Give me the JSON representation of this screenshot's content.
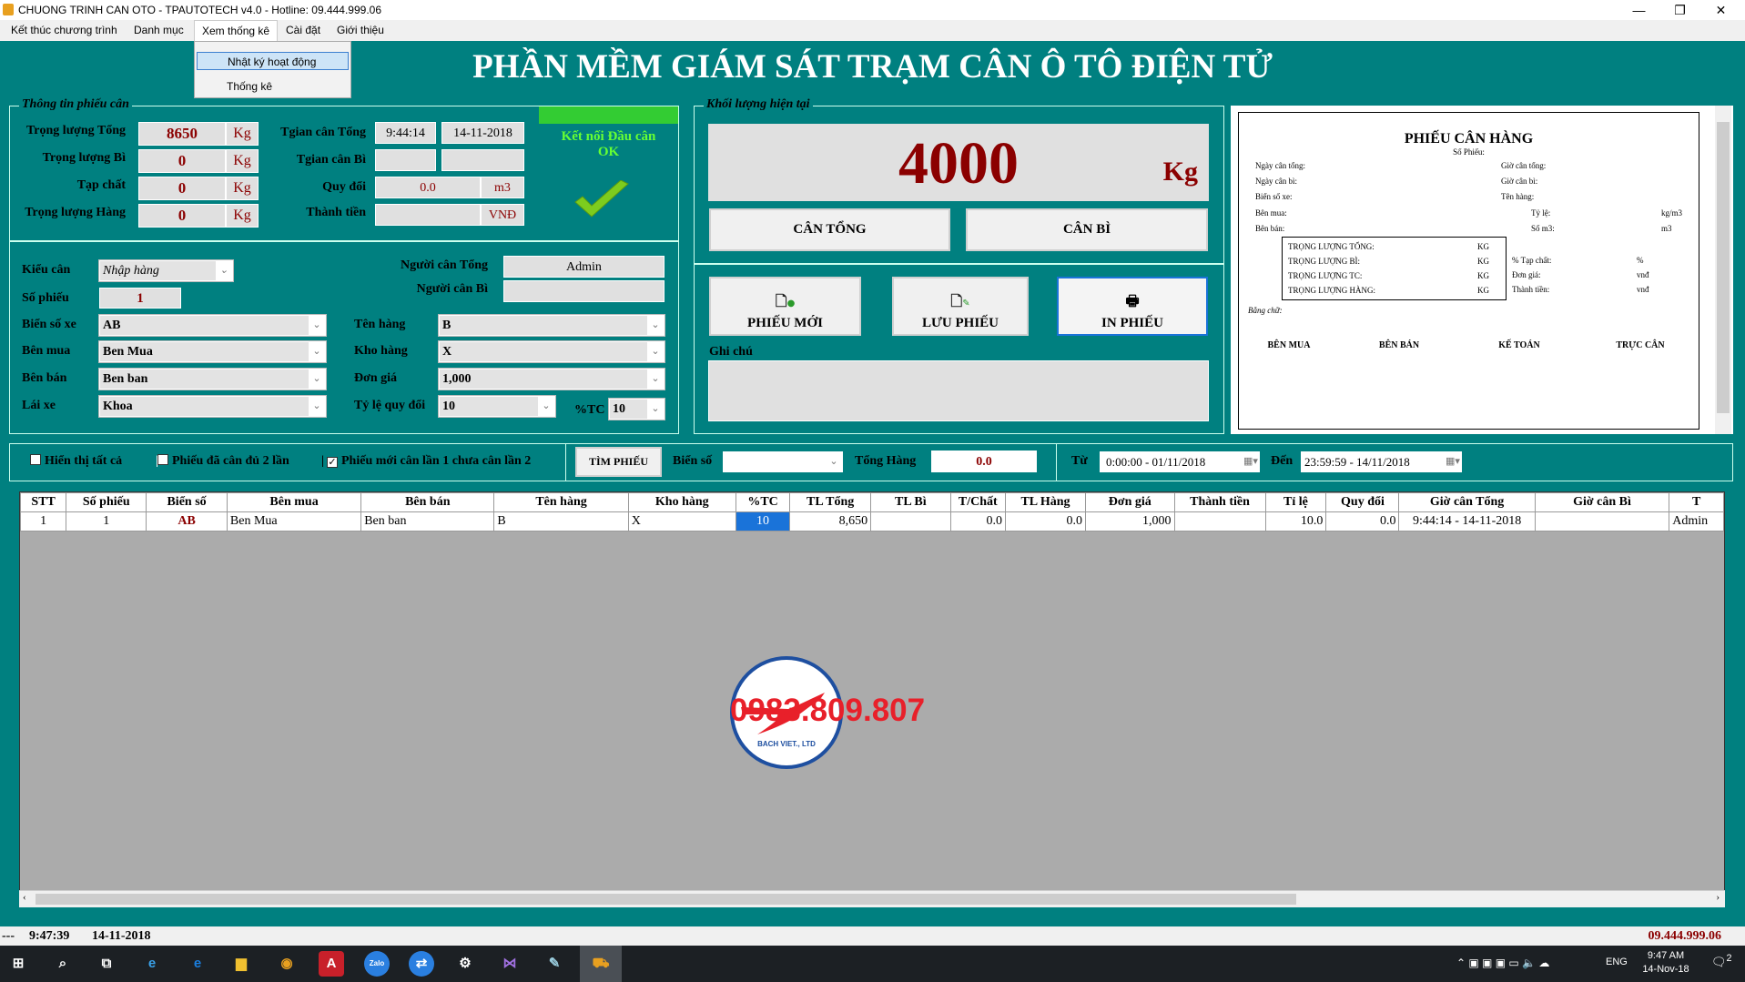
{
  "window": {
    "title": "CHUONG TRINH CAN OTO - TPAUTOTECH v4.0 - Hotline: 09.444.999.06",
    "controls": [
      "—",
      "❐",
      "✕"
    ]
  },
  "menu": {
    "items": [
      "Kết thúc chương trình",
      "Danh mục",
      "Xem thống kê",
      "Cài đặt",
      "Giới thiệu"
    ],
    "open_index": 2,
    "dropdown": [
      "Nhật ký hoạt động",
      "Thống kê"
    ]
  },
  "app_title": "PHẦN MỀM GIÁM SÁT TRẠM CÂN Ô TÔ ĐIỆN TỬ",
  "ticket_info": {
    "legend": "Thông tin phiếu cân",
    "rows": [
      {
        "label": "Trọng lượng Tổng",
        "value": "8650",
        "unit": "Kg"
      },
      {
        "label": "Trọng lượng Bì",
        "value": "0",
        "unit": "Kg"
      },
      {
        "label": "Tạp chất",
        "value": "0",
        "unit": "Kg"
      },
      {
        "label": "Trọng lượng Hàng",
        "value": "0",
        "unit": "Kg"
      }
    ],
    "tgian_tong_label": "Tgian cân Tổng",
    "tgian_tong_time": "9:44:14",
    "tgian_tong_date": "14-11-2018",
    "tgian_bi_label": "Tgian cân Bì",
    "tgian_bi_time": "",
    "tgian_bi_date": "",
    "quy_doi_label": "Quy đổi",
    "quy_doi_value": "0.0",
    "quy_doi_unit": "m3",
    "thanh_tien_label": "Thành tiền",
    "thanh_tien_value": "",
    "thanh_tien_unit": "VNĐ",
    "connection_line1": "Kết nối Đầu cân",
    "connection_line2": "OK",
    "connection_color": "#33cc33"
  },
  "form": {
    "kieu_can_label": "Kiểu cân",
    "kieu_can": "Nhập hàng",
    "so_phieu_label": "Số phiếu",
    "so_phieu": "1",
    "nguoi_can_tong_label": "Người cân Tổng",
    "nguoi_can_tong": "Admin",
    "nguoi_can_bi_label": "Người cân Bì",
    "nguoi_can_bi": "",
    "bien_so_label": "Biển số xe",
    "bien_so": "AB",
    "ben_mua_label": "Bên mua",
    "ben_mua": "Ben Mua",
    "ben_ban_label": "Bên bán",
    "ben_ban": "Ben ban",
    "lai_xe_label": "Lái xe",
    "lai_xe": "Khoa",
    "ten_hang_label": "Tên hàng",
    "ten_hang": "B",
    "kho_hang_label": "Kho hàng",
    "kho_hang": "X",
    "don_gia_label": "Đơn giá",
    "don_gia": "1,000",
    "ty_le_label": "Tỷ lệ quy đổi",
    "ty_le": "10",
    "tc_label": "%TC",
    "tc": "10"
  },
  "weight": {
    "legend": "Khối lượng hiện tại",
    "value": "4000",
    "unit": "Kg",
    "can_tong": "CÂN TỔNG",
    "can_bi": "CÂN BÌ"
  },
  "actions": {
    "phieu_moi": "PHIẾU MỚI",
    "luu_phieu": "LƯU PHIẾU",
    "in_phieu": "IN PHIẾU",
    "ghi_chu_label": "Ghi chú",
    "ghi_chu": ""
  },
  "preview": {
    "title": "PHIẾU CÂN HÀNG",
    "so_phieu": "Số Phiếu:",
    "left": [
      "Ngày cân tổng:",
      "Ngày cân bì:",
      "Biển số xe:",
      "Bên mua:",
      "Bên bán:"
    ],
    "right": [
      "Giờ cân tổng:",
      "Giờ cân bì:",
      "Tên hàng:"
    ],
    "ty_le": "Tỷ lệ:",
    "ty_le_unit": "kg/m3",
    "so_m3": "Số m3:",
    "so_m3_unit": "m3",
    "box": [
      "TRỌNG LƯỢNG TỔNG:",
      "TRỌNG LƯỢNG BÌ:",
      "TRỌNG LƯỢNG TC:",
      "TRỌNG LƯỢNG HÀNG:"
    ],
    "box_unit": "KG",
    "extra": [
      {
        "label": "% Tạp chất:",
        "unit": "%"
      },
      {
        "label": "Đơn giá:",
        "unit": "vnđ"
      },
      {
        "label": "Thành tiền:",
        "unit": "vnđ"
      }
    ],
    "bang_chu": "Bằng chữ:",
    "signatures": [
      "BÊN MUA",
      "BÊN BÁN",
      "KẾ TOÁN",
      "TRỰC CÂN"
    ]
  },
  "filter": {
    "show_all": "Hiển thị tất cả",
    "show_all_checked": false,
    "done_twice": "Phiếu đã cân đủ 2 lần",
    "done_twice_checked": false,
    "new_once": "Phiếu mới cân lần 1 chưa cân lần 2",
    "new_once_checked": true,
    "search_button": "TÌM PHIẾU",
    "bien_so_label": "Biển số",
    "bien_so": "",
    "tong_hang_label": "Tổng Hàng",
    "tong_hang": "0.0",
    "from_label": "Từ",
    "from": "0:00:00 - 01/11/2018",
    "to_label": "Đến",
    "to": "23:59:59 - 14/11/2018"
  },
  "table": {
    "columns": [
      "STT",
      "Số phiếu",
      "Biển số",
      "Bên mua",
      "Bên bán",
      "Tên hàng",
      "Kho hàng",
      "%TC",
      "TL Tổng",
      "TL Bì",
      "T/Chất",
      "TL Hàng",
      "Đơn giá",
      "Thành tiền",
      "Tỉ lệ",
      "Quy đổi",
      "Giờ cân Tổng",
      "Giờ cân Bì",
      "T"
    ],
    "rows": [
      [
        "1",
        "1",
        "AB",
        "Ben Mua",
        "Ben ban",
        "B",
        "X",
        "10",
        "8,650",
        "",
        "0.0",
        "0.0",
        "1,000",
        "",
        "10.0",
        "0.0",
        "9:44:14 - 14-11-2018",
        "",
        "Admin"
      ]
    ]
  },
  "logo": {
    "company": "BACH VIET., LTD",
    "phone": "0983.809.807"
  },
  "status": {
    "prefix": "---",
    "time": "9:47:39",
    "date": "14-11-2018",
    "hotline": "09.444.999.06"
  },
  "taskbar": {
    "time": "9:47 AM",
    "date": "14-Nov-18",
    "lang": "ENG",
    "notifications": "2"
  }
}
